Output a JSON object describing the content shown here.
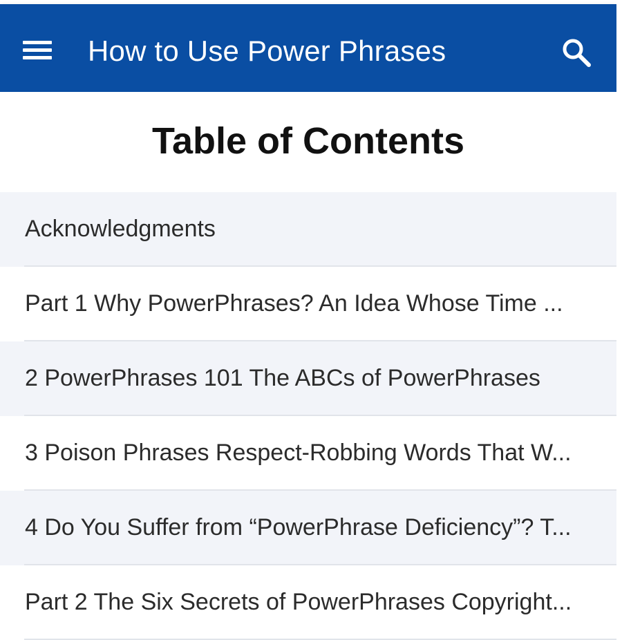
{
  "appbar": {
    "title": "How to Use Power Phrases",
    "menu_icon": "hamburger-menu-icon",
    "search_icon": "search-icon",
    "color": "#0a4ea3"
  },
  "page": {
    "heading": "Table of Contents"
  },
  "toc": {
    "items": [
      {
        "label": "Acknowledgments"
      },
      {
        "label": "Part 1 Why PowerPhrases? An Idea Whose Time ..."
      },
      {
        "label": "2 PowerPhrases 101 The ABCs of PowerPhrases"
      },
      {
        "label": "3 Poison Phrases Respect-Robbing Words That W..."
      },
      {
        "label": "4 Do You Suffer from “PowerPhrase Deficiency”? T..."
      },
      {
        "label": "Part 2 The Six Secrets of PowerPhrases Copyright..."
      }
    ]
  }
}
